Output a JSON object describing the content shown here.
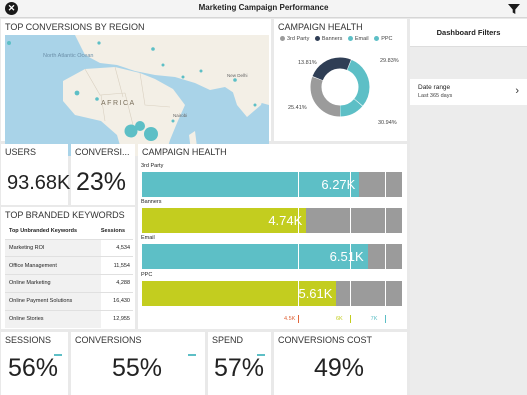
{
  "app": {
    "title": "Marketing Campaign Performance"
  },
  "colors": {
    "teal": "#5dbfc6",
    "lime": "#c3cd1f",
    "gray": "#9b9b9b",
    "navy": "#2f3e55",
    "orange": "#e0653a"
  },
  "map": {
    "title": "TOP CONVERSIONS BY REGION",
    "labels": {
      "ocean": "North Atlantic Ocean",
      "continent": "AFRICA",
      "city1": "New Delhi",
      "city2": "Nairobi"
    }
  },
  "donut": {
    "title": "CAMPAIGN HEALTH",
    "legend": [
      "3rd Party",
      "Banners",
      "Email",
      "PPC"
    ],
    "pcts": [
      "13.81%",
      "29.83%",
      "25.41%",
      "30.94%"
    ]
  },
  "filters": {
    "title": "Dashboard Filters",
    "items": [
      {
        "label": "Date range",
        "value": "Last 365 days"
      }
    ]
  },
  "kpis": {
    "users": {
      "label": "USERS",
      "value": "93.68K"
    },
    "conversions": {
      "label": "CONVERSI...",
      "value": "23%"
    }
  },
  "keywords": {
    "title": "TOP BRANDED KEYWORDS",
    "columns": [
      "Top Unbranded Keywords",
      "Sessions"
    ],
    "rows": [
      {
        "keyword": "Marketing ROI",
        "sessions": "4,534"
      },
      {
        "keyword": "Office Management",
        "sessions": "11,554"
      },
      {
        "keyword": "Online Marketing",
        "sessions": "4,288"
      },
      {
        "keyword": "Online Payment Solutions",
        "sessions": "16,430"
      },
      {
        "keyword": "Online Stories",
        "sessions": "12,955"
      }
    ]
  },
  "bars": {
    "title": "CAMPAIGN HEALTH",
    "items": [
      {
        "label": "3rd Party",
        "display": "6.27K"
      },
      {
        "label": "Banners",
        "display": "4.74K"
      },
      {
        "label": "Email",
        "display": "6.51K"
      },
      {
        "label": "PPC",
        "display": "5.61K"
      }
    ],
    "axis": [
      "4.5K",
      "6K",
      "7K"
    ]
  },
  "bottom": {
    "sessions": {
      "label": "SESSIONS",
      "value": "56%"
    },
    "conversions": {
      "label": "CONVERSIONS",
      "value": "55%"
    },
    "spend": {
      "label": "SPEND",
      "value": "57%"
    },
    "cost": {
      "label": "CONVERSIONS COST",
      "value": "49%"
    }
  },
  "chart_data": [
    {
      "type": "pie",
      "title": "CAMPAIGN HEALTH",
      "categories": [
        "3rd Party",
        "Banners",
        "Email",
        "PPC"
      ],
      "values": [
        30.94,
        25.41,
        29.83,
        13.81
      ]
    },
    {
      "type": "bar",
      "title": "CAMPAIGN HEALTH",
      "categories": [
        "3rd Party",
        "Banners",
        "Email",
        "PPC"
      ],
      "values": [
        6270,
        4740,
        6510,
        5610
      ],
      "xlim": [
        0,
        7500
      ],
      "thresholds": [
        4500,
        6000,
        7000
      ]
    }
  ]
}
